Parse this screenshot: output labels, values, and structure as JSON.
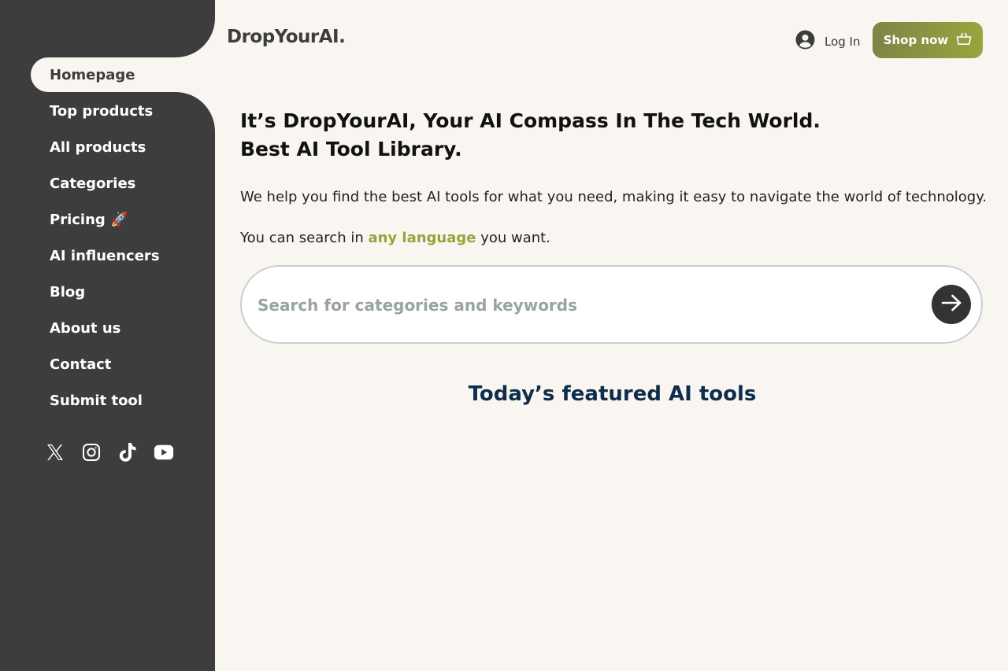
{
  "brand": {
    "logo_text": "DropYourAI."
  },
  "sidebar": {
    "items": [
      {
        "label": "Homepage",
        "active": true
      },
      {
        "label": "Top products"
      },
      {
        "label": "All products"
      },
      {
        "label": "Categories"
      },
      {
        "label": "Pricing 🚀"
      },
      {
        "label": "AI influencers"
      },
      {
        "label": "Blog"
      },
      {
        "label": "About us"
      },
      {
        "label": "Contact"
      },
      {
        "label": "Submit tool"
      }
    ],
    "socials": [
      "x-icon",
      "instagram-icon",
      "tiktok-icon",
      "youtube-icon"
    ]
  },
  "header": {
    "login_label": "Log In",
    "shop_label": "Shop now"
  },
  "hero": {
    "headline_line1": "It’s DropYourAI, Your AI Compass In The Tech World.",
    "headline_line2": "Best AI Tool Library.",
    "description": "We help you find the best AI tools for what you need, making it easy to navigate the world of technology.",
    "search_note_prefix": "You can search in ",
    "search_note_accent": "any language",
    "search_note_suffix": " you want."
  },
  "search": {
    "placeholder": "Search for categories and keywords",
    "value": ""
  },
  "featured": {
    "title": "Today’s featured AI tools"
  },
  "colors": {
    "sidebar_bg": "#3d3d3d",
    "page_bg": "#f9f6f2",
    "accent": "#98a33a",
    "featured_title": "#0f2d4a"
  }
}
